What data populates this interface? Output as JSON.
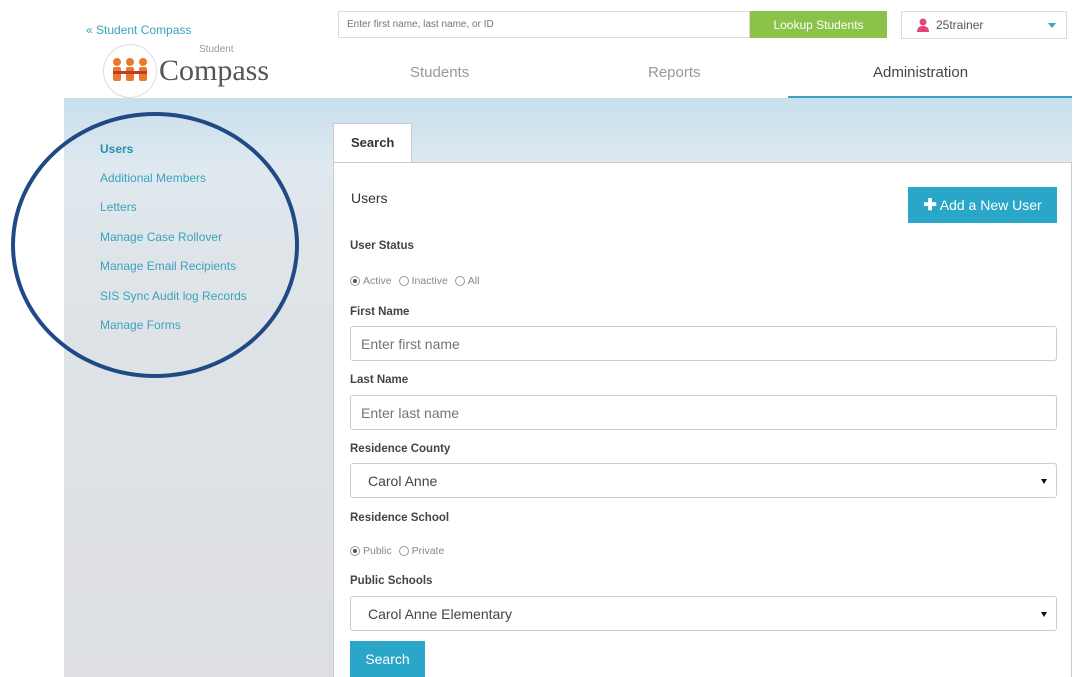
{
  "header": {
    "back_link": "« Student Compass",
    "logo_text": "Compass",
    "logo_sub": "Student",
    "search_placeholder": "Enter first name, last name, or ID",
    "lookup_button": "Lookup Students",
    "user_name": "25trainer",
    "user_icon_color": "#e0457b",
    "accent": "#3aa3bd"
  },
  "nav": {
    "tabs": [
      {
        "label": "Students"
      },
      {
        "label": "Reports"
      },
      {
        "label": "Administration"
      }
    ],
    "active": "Administration"
  },
  "sidebar": {
    "items": [
      {
        "label": "Users",
        "active": true
      },
      {
        "label": "Additional Members"
      },
      {
        "label": "Letters"
      },
      {
        "label": "Manage Case Rollover"
      },
      {
        "label": "Manage Email Recipients"
      },
      {
        "label": "SIS Sync Audit log Records"
      },
      {
        "label": "Manage Forms"
      }
    ]
  },
  "panel": {
    "tab_label": "Search",
    "title": "Users",
    "add_button": "Add a New User",
    "add_icon": "plus-icon",
    "user_status_label": "User Status",
    "status_options": [
      "Active",
      "Inactive",
      "All"
    ],
    "status_selected": "Active",
    "first_name_label": "First Name",
    "first_name_placeholder": "Enter first name",
    "last_name_label": "Last Name",
    "last_name_placeholder": "Enter last name",
    "residence_county_label": "Residence County",
    "residence_county_value": "Carol Anne",
    "residence_school_label": "Residence School",
    "school_options": [
      "Public",
      "Private"
    ],
    "school_selected": "Public",
    "public_schools_label": "Public Schools",
    "public_schools_value": "Carol Anne Elementary",
    "search_button": "Search"
  },
  "annotation": {
    "circle_color": "#204a86"
  }
}
